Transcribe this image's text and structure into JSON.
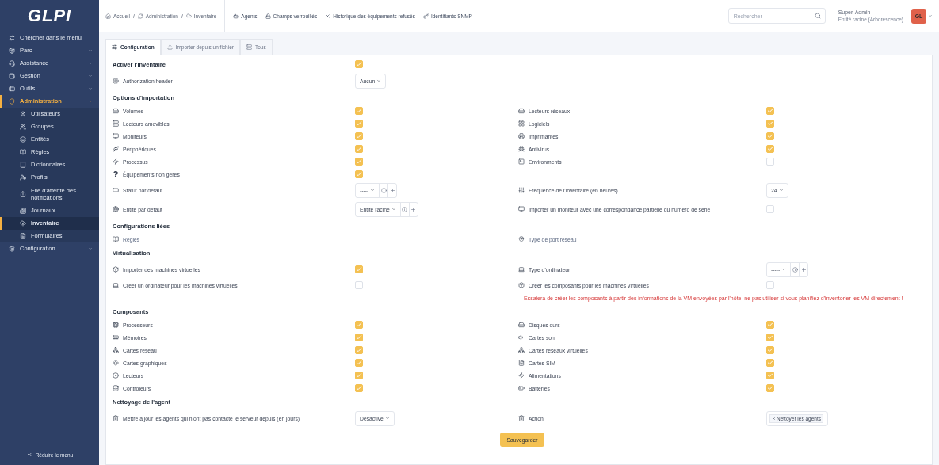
{
  "sidebar": {
    "logo": "GLPI",
    "search": "Chercher dans le menu",
    "items": [
      {
        "label": "Parc",
        "selected": false
      },
      {
        "label": "Assistance",
        "selected": false
      },
      {
        "label": "Gestion",
        "selected": false
      },
      {
        "label": "Outils",
        "selected": false
      },
      {
        "label": "Administration",
        "selected": true,
        "children": [
          {
            "label": "Utilisateurs",
            "selected": false
          },
          {
            "label": "Groupes",
            "selected": false
          },
          {
            "label": "Entités",
            "selected": false
          },
          {
            "label": "Règles",
            "selected": false
          },
          {
            "label": "Dictionnaires",
            "selected": false
          },
          {
            "label": "Profils",
            "selected": false
          },
          {
            "label": "File d'attente des notifications",
            "selected": false
          },
          {
            "label": "Journaux",
            "selected": false
          },
          {
            "label": "Inventaire",
            "selected": true
          },
          {
            "label": "Formulaires",
            "selected": false
          }
        ]
      },
      {
        "label": "Configuration",
        "selected": false
      }
    ],
    "collapse": "Réduire le menu"
  },
  "header": {
    "breadcrumbs": [
      {
        "kind": "link",
        "label": "Accueil"
      },
      {
        "kind": "separator",
        "label": "/"
      },
      {
        "kind": "link",
        "label": "Administration"
      },
      {
        "kind": "separator",
        "label": "/"
      },
      {
        "kind": "link",
        "label": "Inventaire"
      }
    ],
    "links": [
      "Agents",
      "Champs verrouillés",
      "Historique des équipements refusés",
      "Identifiants SNMP"
    ],
    "search": {
      "placeholder": "Rechercher"
    },
    "user": {
      "name": "Super-Admin",
      "entity": "Entité racine (Arborescence)",
      "initials": "GL"
    }
  },
  "tabs": [
    {
      "label": "Configuration",
      "selected": true
    },
    {
      "label": "Importer depuis un fichier",
      "selected": false
    },
    {
      "label": "Tous",
      "selected": false
    }
  ],
  "sections": [
    {
      "title": "Activer l'inventaire",
      "control": {
        "kind": "checkbox",
        "checked": true
      },
      "rows": [
        {
          "left": {
            "label": "Authorization header",
            "control": {
              "kind": "select",
              "value": "Aucun"
            }
          }
        }
      ]
    },
    {
      "title": "Options d'importation",
      "rows": [
        {
          "left": {
            "label": "Volumes",
            "control": {
              "kind": "checkbox",
              "checked": true
            }
          },
          "right": {
            "label": "Lecteurs réseaux",
            "control": {
              "kind": "checkbox",
              "checked": true
            }
          }
        },
        {
          "left": {
            "label": "Lecteurs amovibles",
            "control": {
              "kind": "checkbox",
              "checked": true
            }
          },
          "right": {
            "label": "Logiciels",
            "control": {
              "kind": "checkbox",
              "checked": true
            }
          }
        },
        {
          "left": {
            "label": "Moniteurs",
            "control": {
              "kind": "checkbox",
              "checked": true
            }
          },
          "right": {
            "label": "Imprimantes",
            "control": {
              "kind": "checkbox",
              "checked": true
            }
          }
        },
        {
          "left": {
            "label": "Périphériques",
            "control": {
              "kind": "checkbox",
              "checked": true
            }
          },
          "right": {
            "label": "Antivirus",
            "control": {
              "kind": "checkbox",
              "checked": true
            }
          }
        },
        {
          "left": {
            "label": "Processus",
            "control": {
              "kind": "checkbox",
              "checked": true
            }
          },
          "right": {
            "label": "Environments",
            "control": {
              "kind": "checkbox",
              "checked": false
            }
          }
        },
        {
          "left": {
            "label": "Équipements non gérés",
            "control": {
              "kind": "checkbox",
              "checked": true
            }
          }
        },
        {
          "left": {
            "label": "Statut par défaut",
            "control": {
              "kind": "select-plus",
              "value": "-----"
            }
          },
          "right": {
            "label": "Fréquence de l'inventaire (en heures)",
            "control": {
              "kind": "select",
              "value": "24"
            }
          }
        },
        {
          "left": {
            "label": "Entité par défaut",
            "control": {
              "kind": "select-plus",
              "value": "Entité racine"
            }
          },
          "right": {
            "label": "Importer un moniteur avec une correspondance partielle du numéro de série",
            "control": {
              "kind": "checkbox",
              "checked": false
            }
          }
        }
      ]
    },
    {
      "title": "Configurations liées",
      "rows": [
        {
          "left": {
            "label": "Règles",
            "kind": "link"
          },
          "right": {
            "label": "Type de port réseau",
            "kind": "link"
          }
        }
      ]
    },
    {
      "title": "Virtualisation",
      "rows": [
        {
          "left": {
            "label": "Importer des machines virtuelles",
            "control": {
              "kind": "checkbox",
              "checked": true
            }
          },
          "right": {
            "label": "Type d'ordinateur",
            "control": {
              "kind": "select-plus",
              "value": "-----"
            }
          }
        },
        {
          "left": {
            "label": "Créer un ordinateur pour les machines virtuelles",
            "control": {
              "kind": "checkbox",
              "checked": false
            }
          },
          "right": {
            "label": "Créer les composants pour les machines virtuelles",
            "control": {
              "kind": "checkbox",
              "checked": false
            }
          }
        },
        {
          "right": {
            "kind": "warning",
            "label": "Essaiera de créer les composants à partir des informations de la VM envoyées par l'hôte, ne pas utiliser si vous planifiez d'inventorier les VM directement !"
          }
        }
      ]
    },
    {
      "title": "Composants",
      "rows": [
        {
          "left": {
            "label": "Processeurs",
            "control": {
              "kind": "checkbox",
              "checked": true
            }
          },
          "right": {
            "label": "Disques durs",
            "control": {
              "kind": "checkbox",
              "checked": true
            }
          }
        },
        {
          "left": {
            "label": "Mémoires",
            "control": {
              "kind": "checkbox",
              "checked": true
            }
          },
          "right": {
            "label": "Cartes son",
            "control": {
              "kind": "checkbox",
              "checked": true
            }
          }
        },
        {
          "left": {
            "label": "Cartes réseau",
            "control": {
              "kind": "checkbox",
              "checked": true
            }
          },
          "right": {
            "label": "Cartes réseaux virtuelles",
            "control": {
              "kind": "checkbox",
              "checked": true
            }
          }
        },
        {
          "left": {
            "label": "Cartes graphiques",
            "control": {
              "kind": "checkbox",
              "checked": true
            }
          },
          "right": {
            "label": "Cartes SIM",
            "control": {
              "kind": "checkbox",
              "checked": true
            }
          }
        },
        {
          "left": {
            "label": "Lecteurs",
            "control": {
              "kind": "checkbox",
              "checked": true
            }
          },
          "right": {
            "label": "Alimentations",
            "control": {
              "kind": "checkbox",
              "checked": true
            }
          }
        },
        {
          "left": {
            "label": "Contrôleurs",
            "control": {
              "kind": "checkbox",
              "checked": true
            }
          },
          "right": {
            "label": "Batteries",
            "control": {
              "kind": "checkbox",
              "checked": true
            }
          }
        }
      ]
    },
    {
      "title": "Nettoyage de l'agent",
      "rows": [
        {
          "left": {
            "label": "Mettre à jour les agents qui n'ont pas contacté le serveur depuis (en jours)",
            "control": {
              "kind": "select",
              "value": "Désactivé"
            }
          },
          "right": {
            "label": "Action",
            "control": {
              "kind": "tags",
              "value": "Nettoyer les agents"
            }
          }
        }
      ]
    }
  ],
  "save_button": "Sauvegarder"
}
